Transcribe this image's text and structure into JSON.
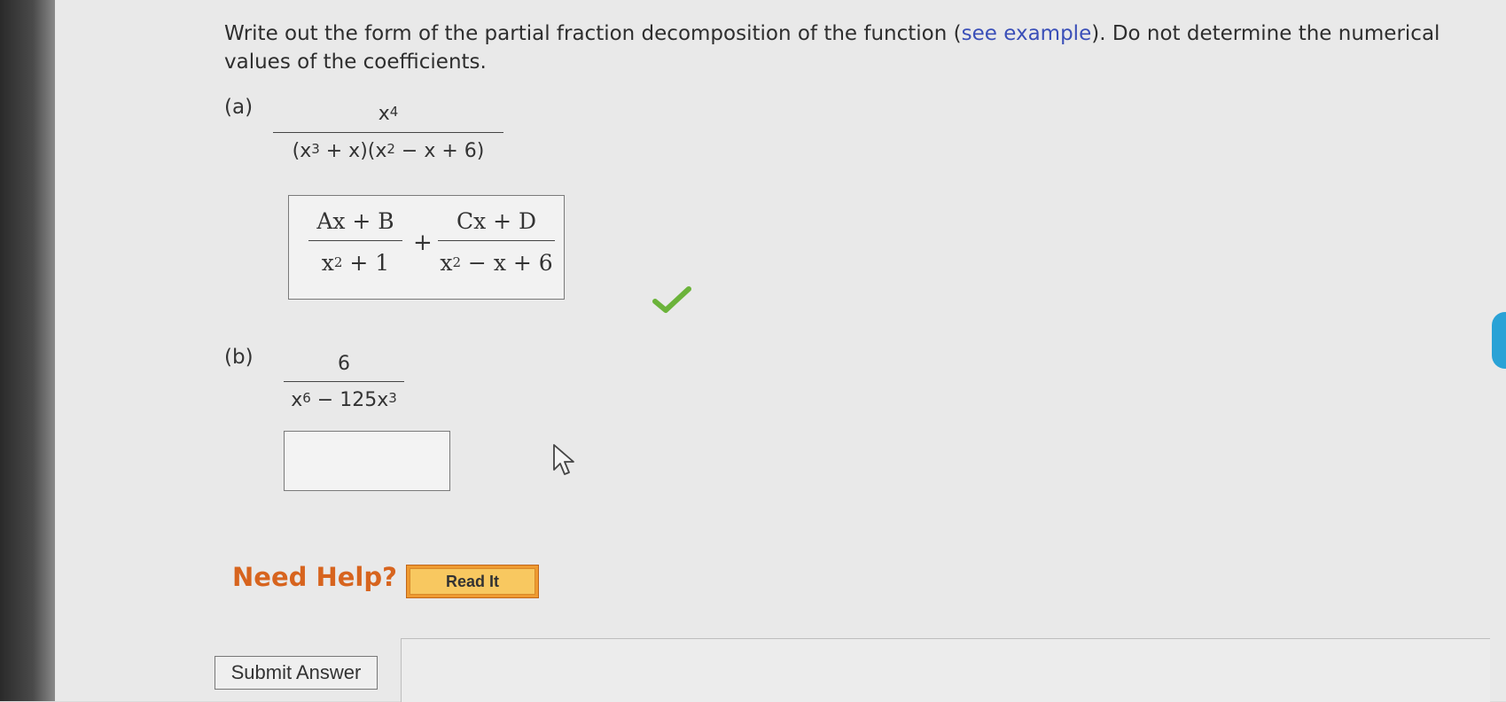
{
  "instructions": {
    "text_before_link": "Write out the form of the partial fraction decomposition of the function (",
    "link": "see example",
    "text_after_link": "). Do not determine the numerical values of the coefficients."
  },
  "part_a": {
    "label": "(a)",
    "numerator": "x",
    "numerator_exp": "4",
    "denominator_parts": [
      "(x",
      "3",
      " + x)(x",
      "2",
      " − x + 6)"
    ],
    "answer": {
      "frac1_numerator": "Ax + B",
      "frac1_denominator_base": "x",
      "frac1_denominator_exp": "2",
      "frac1_denominator_rest": " + 1",
      "plus": "+",
      "frac2_numerator": "Cx + D",
      "frac2_denominator_base": "x",
      "frac2_denominator_exp": "2",
      "frac2_denominator_rest": " − x + 6"
    },
    "status": "correct"
  },
  "part_b": {
    "label": "(b)",
    "numerator": "6",
    "denominator_parts": [
      "x",
      "6",
      " − 125x",
      "3"
    ],
    "answer": ""
  },
  "help": {
    "label": "Need Help?",
    "read_it": "Read It"
  },
  "submit": {
    "label": "Submit Answer"
  },
  "colors": {
    "link": "#3a4fb8",
    "help_text": "#d7641e",
    "read_it_button": "#ef9a30",
    "check": "#6bb33a",
    "side_tab": "#2aa2d6"
  }
}
